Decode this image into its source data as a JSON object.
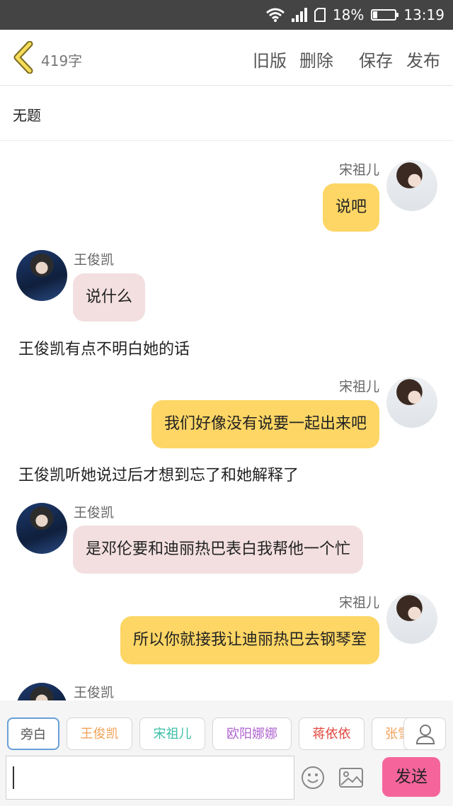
{
  "status_bar": {
    "battery_percent": "18%",
    "battery_level": 0.18,
    "time": "13:19"
  },
  "header": {
    "word_count": "419字",
    "actions": {
      "old_version": "旧版",
      "delete": "删除",
      "save": "保存",
      "publish": "发布"
    }
  },
  "story": {
    "title": "无题"
  },
  "messages": [
    {
      "type": "bubble",
      "side": "right",
      "speaker": "宋祖儿",
      "text": "说吧"
    },
    {
      "type": "bubble",
      "side": "left",
      "speaker": "王俊凯",
      "text": "说什么"
    },
    {
      "type": "narration",
      "text": "王俊凯有点不明白她的话"
    },
    {
      "type": "bubble",
      "side": "right",
      "speaker": "宋祖儿",
      "text": "我们好像没有说要一起出来吧"
    },
    {
      "type": "narration",
      "text": "王俊凯听她说过后才想到忘了和她解释了"
    },
    {
      "type": "bubble",
      "side": "left",
      "speaker": "王俊凯",
      "text": "是邓伦要和迪丽热巴表白我帮他一个忙"
    },
    {
      "type": "bubble",
      "side": "right",
      "speaker": "宋祖儿",
      "text": "所以你就接我让迪丽热巴去钢琴室"
    },
    {
      "type": "bubble",
      "side": "left",
      "speaker": "王俊凯",
      "text": ""
    }
  ],
  "character_bar": {
    "characters": [
      {
        "label": "旁白",
        "color": "#555555"
      },
      {
        "label": "王俊凯",
        "color": "#f0a25a"
      },
      {
        "label": "宋祖儿",
        "color": "#3cbfa8"
      },
      {
        "label": "欧阳娜娜",
        "color": "#b066d0"
      },
      {
        "label": "蒋依依",
        "color": "#e0453c"
      },
      {
        "label": "张雪",
        "color": "#f0a25a"
      }
    ]
  },
  "composer": {
    "input_value": "",
    "send_label": "发送"
  }
}
